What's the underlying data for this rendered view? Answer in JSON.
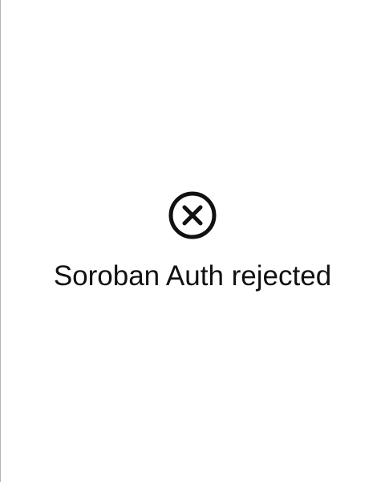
{
  "status": {
    "icon": "close-circle-icon",
    "message": "Soroban Auth rejected",
    "color": "#111111"
  }
}
